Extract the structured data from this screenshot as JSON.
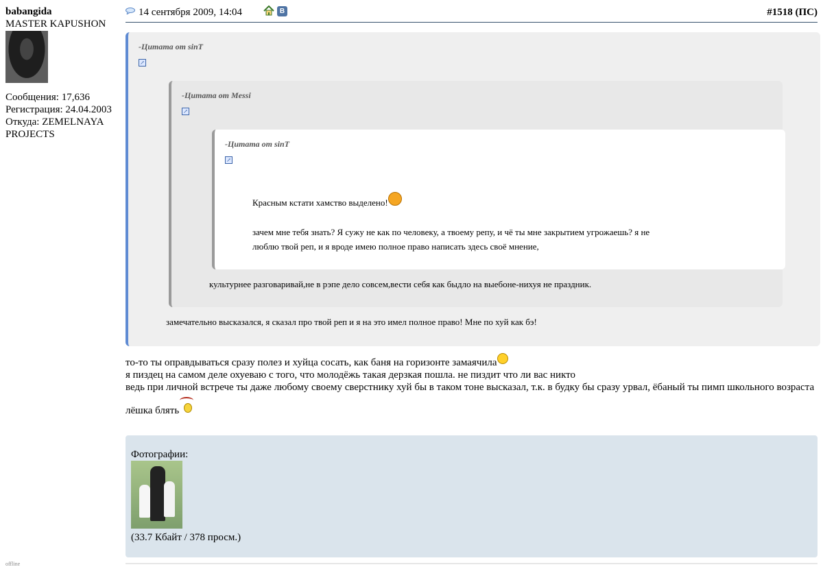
{
  "user": {
    "name": "babangida",
    "title": "MASTER KAPUSHON",
    "posts": "Сообщения: 17,636",
    "registered": "Регистрация: 24.04.2003",
    "from": "Откуда: ZEMELNAYA PROJECTS",
    "status": "offline"
  },
  "post": {
    "date": "14 сентября 2009, 14:04",
    "number": "#1518",
    "number_suffix": "(ПС)",
    "icons": [
      "message-icon",
      "home-icon",
      "vk-icon"
    ]
  },
  "quotes": {
    "q1": {
      "header": "-Цитата от sinT",
      "text": "замечательно высказался, я сказал про твой реп и я на это имел полное право! Мне по хуй как бэ!"
    },
    "q2": {
      "header": "-Цитата от Messi",
      "text": "культурнее разговаривай,не в рэпе дело совсем,вести себя как быдло на выебоне-нихуя не праздник."
    },
    "q3": {
      "header": "-Цитата от sinT",
      "line1": "Красным кстати хамство выделено!",
      "line2": "зачем мне тебя знать? Я сужу не как по человеку, а твоему репу, и чё ты мне закрытием угрожаешь? я не",
      "line3": "люблю твой реп, и я вроде имею полное право написать здесь своё мнение,"
    }
  },
  "body": {
    "line1": "то-то ты оправдываться сразу полез и хуйца сосать, как баня на горизонте замаячила",
    "line2": "я пиздец на самом деле охуеваю с того, что молодёжь такая дерзкая пошла. не пиздит что ли вас никто",
    "line3": "ведь при личной встрече ты даже любому своему сверстнику хуй бы в таком тоне высказал, т.к. в будку бы сразу урвал, ёбаный ты пимп школьного возраста",
    "line4": "лёшка блять"
  },
  "attachments": {
    "caption": "Фотографии:",
    "size": "(33.7 Кбайт / 378 просм.)"
  }
}
